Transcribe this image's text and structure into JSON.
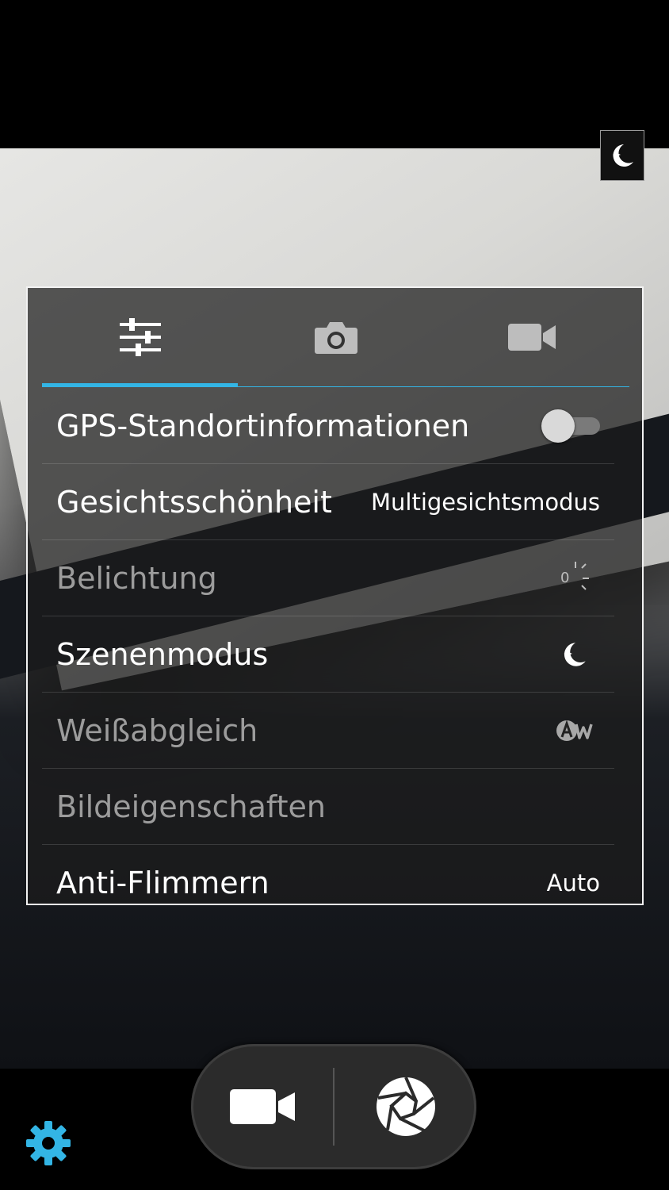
{
  "panel": {
    "tabs": [
      {
        "icon": "sliders-icon",
        "active": true
      },
      {
        "icon": "camera-icon",
        "active": false
      },
      {
        "icon": "video-camera-icon",
        "active": false
      }
    ],
    "items": [
      {
        "label": "GPS-Standortinformationen",
        "control": "toggle",
        "on": false,
        "enabled": true
      },
      {
        "label": "Gesichtsschönheit",
        "value": "Multigesichtsmodus",
        "enabled": true
      },
      {
        "label": "Belichtung",
        "value": "0",
        "icon": "exposure-icon",
        "enabled": false
      },
      {
        "label": "Szenenmodus",
        "icon": "night-mode-icon",
        "enabled": true
      },
      {
        "label": "Weißabgleich",
        "icon": "auto-white-balance-icon",
        "enabled": false
      },
      {
        "label": "Bildeigenschaften",
        "enabled": false
      },
      {
        "label": "Anti-Flimmern",
        "value": "Auto",
        "enabled": true
      }
    ]
  },
  "indicator": {
    "icon": "night-mode-icon"
  },
  "controls": {
    "video_icon": "video-camera-icon",
    "shutter_icon": "shutter-icon",
    "settings_icon": "gear-icon"
  },
  "colors": {
    "accent": "#33b5e5",
    "panel_border": "#f2f2f2"
  }
}
